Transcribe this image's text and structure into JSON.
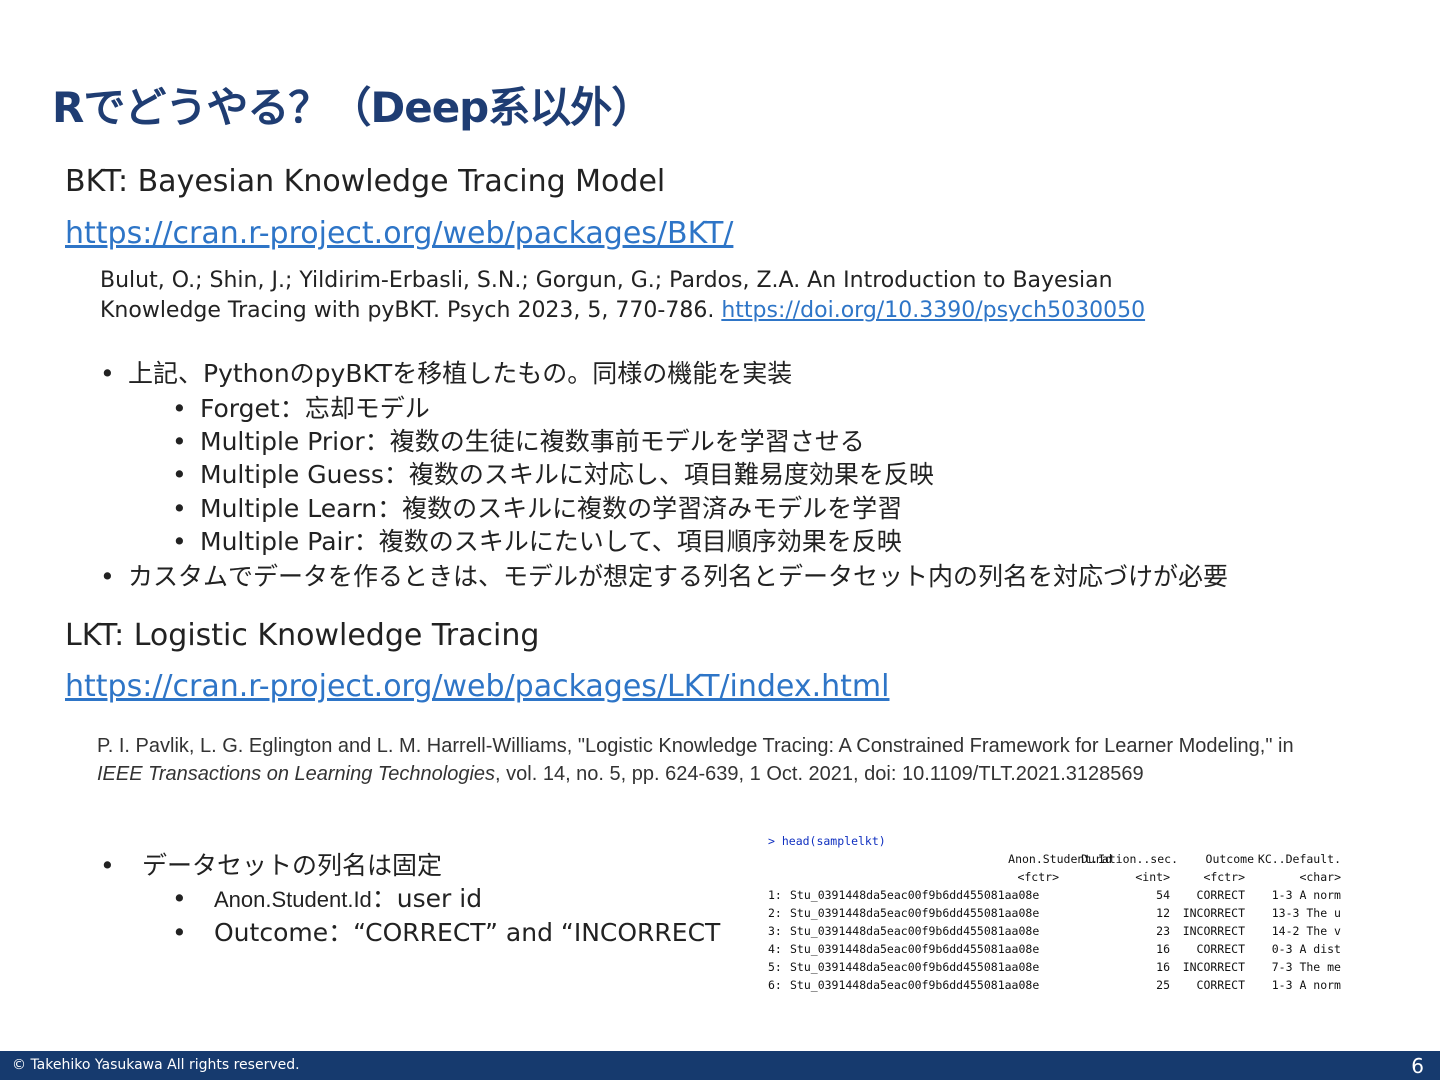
{
  "title": "Rでどうやる？（Deep系以外）",
  "bkt": {
    "heading": "BKT: Bayesian Knowledge Tracing Model",
    "url": "https://cran.r-project.org/web/packages/BKT/",
    "ref_line1": "Bulut, O.; Shin, J.; Yildirim-Erbasli, S.N.; Gorgun, G.; Pardos, Z.A. An Introduction to Bayesian",
    "ref_line2": "Knowledge Tracing with pyBKT. Psych 2023, 5, 770-786.",
    "ref_doi": "https://doi.org/10.3390/psych5030050",
    "bullet1": "上記、PythonのpyBKTを移植したもの。同様の機能を実装",
    "sub_items": [
      {
        "term": "Forget",
        "desc": "：忘却モデル"
      },
      {
        "term": "Multiple Prior",
        "desc": "：複数の生徒に複数事前モデルを学習させる"
      },
      {
        "term": "Multiple Guess",
        "desc": "：複数のスキルに対応し、項目難易度効果を反映"
      },
      {
        "term": "Multiple Learn",
        "desc": "：複数のスキルに複数の学習済みモデルを学習"
      },
      {
        "term": "Multiple Pair",
        "desc": "：複数のスキルにたいして、項目順序効果を反映"
      }
    ],
    "bullet2": "カスタムでデータを作るときは、モデルが想定する列名とデータセット内の列名を対応づけが必要"
  },
  "lkt": {
    "heading": "LKT: Logistic Knowledge Tracing",
    "url": "https://cran.r-project.org/web/packages/LKT/index.html",
    "ref_a": "P. I. Pavlik, L. G. Eglington and L. M. Harrell-Williams, \"Logistic Knowledge Tracing: A Constrained Framework for Learner Modeling,\" in ",
    "ref_journal": "IEEE Transactions on Learning Technologies",
    "ref_b": ", vol. 14, no. 5, pp. 624-639, 1 Oct. 2021, doi: 10.1109/TLT.2021.3128569",
    "bullet1": "データセットの列名は固定",
    "sub_items": [
      {
        "term": "Anon.Student.Id",
        "desc": "：user id"
      },
      {
        "term": "Outcome",
        "desc": "：“CORRECT” and “INCORRECT"
      }
    ]
  },
  "console": {
    "command": "> head(samplelkt)",
    "columns": [
      "Anon.Student.Id",
      "Duration..sec.",
      "Outcome",
      "KC..Default."
    ],
    "types": [
      "<fctr>",
      "<int>",
      "<fctr>",
      "<char>"
    ],
    "rows": [
      [
        "1:",
        "Stu_0391448da5eac00f9b6dd455081aa08e",
        "54",
        "CORRECT",
        "1-3 A norm"
      ],
      [
        "2:",
        "Stu_0391448da5eac00f9b6dd455081aa08e",
        "12",
        "INCORRECT",
        "13-3 The u"
      ],
      [
        "3:",
        "Stu_0391448da5eac00f9b6dd455081aa08e",
        "23",
        "INCORRECT",
        "14-2 The v"
      ],
      [
        "4:",
        "Stu_0391448da5eac00f9b6dd455081aa08e",
        "16",
        "CORRECT",
        "0-3 A dist"
      ],
      [
        "5:",
        "Stu_0391448da5eac00f9b6dd455081aa08e",
        "16",
        "INCORRECT",
        "7-3 The me"
      ],
      [
        "6:",
        "Stu_0391448da5eac00f9b6dd455081aa08e",
        "25",
        "CORRECT",
        "1-3 A norm"
      ]
    ]
  },
  "footer": {
    "copyright": "© Takehiko Yasukawa All rights reserved.",
    "page": "6"
  }
}
